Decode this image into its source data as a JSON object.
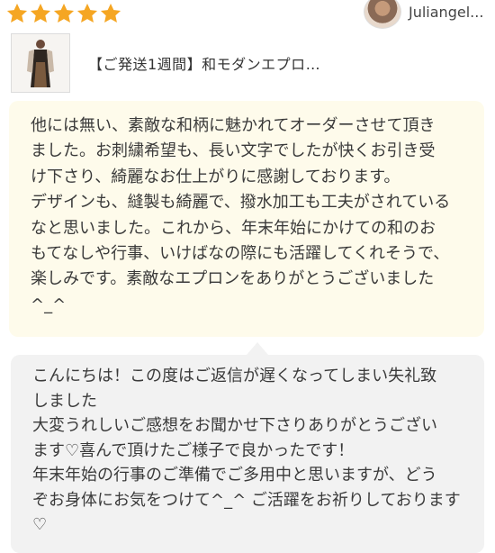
{
  "rating": {
    "value": 5,
    "max": 5,
    "star_color": "#f5a623"
  },
  "reviewer": {
    "name": "Juliangel..."
  },
  "product": {
    "title": "【ご発送1週間】和モダンエプロ…"
  },
  "review": {
    "text": "他には無い、素敵な和柄に魅かれてオーダーさせて頂き\nました。お刺繍希望も、長い文字でしたが快くお引き受\nけ下さり、綺麗なお仕上がりに感謝しております。\nデザインも、縫製も綺麗で、撥水加工も工夫がされている\nなと思いました。これから、年末年始にかけての和のお\nもてなしや行事、いけばなの際にも活躍してくれそうで、\n楽しみです。素敵なエプロンをありがとうございました\n^_^"
  },
  "reply": {
    "text": "こんにちは！この度はご返信が遅くなってしまい失礼致\nしました\n大変うれしいご感想をお聞かせ下さりありがとうござい\nます♡喜んで頂けたご様子で良かったです！\n年末年始の行事のご準備でご多用中と思いますが、どう\nぞお身体にお気をつけて^_^ ご活躍をお祈りしております\n♡"
  },
  "colors": {
    "review_bg": "#fefbeb",
    "reply_bg": "#f2f2f2"
  }
}
